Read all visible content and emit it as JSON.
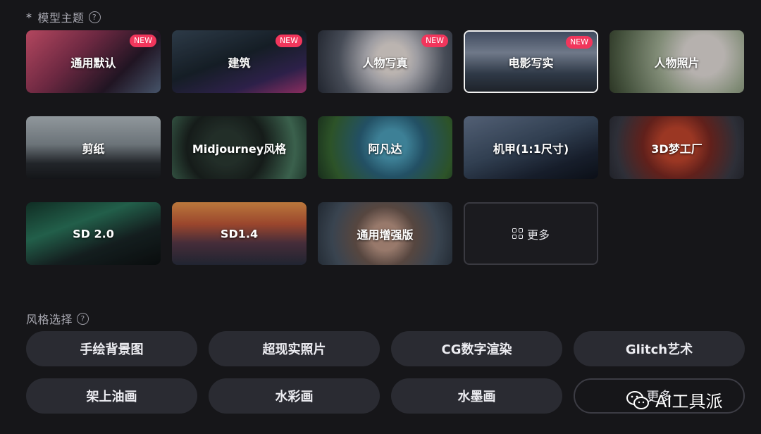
{
  "model_section": {
    "required_mark": "*",
    "title": "模型主题",
    "help_symbol": "?"
  },
  "models": [
    {
      "label": "通用默认",
      "badge": "NEW",
      "selected": false
    },
    {
      "label": "建筑",
      "badge": "NEW",
      "selected": false
    },
    {
      "label": "人物写真",
      "badge": "NEW",
      "selected": false
    },
    {
      "label": "电影写实",
      "badge": "NEW",
      "selected": true
    },
    {
      "label": "人物照片",
      "badge": "",
      "selected": false
    },
    {
      "label": "剪纸",
      "badge": "",
      "selected": false
    },
    {
      "label": "Midjourney风格",
      "badge": "",
      "selected": false
    },
    {
      "label": "阿凡达",
      "badge": "",
      "selected": false
    },
    {
      "label": "机甲(1:1尺寸)",
      "badge": "",
      "selected": false
    },
    {
      "label": "3D梦工厂",
      "badge": "",
      "selected": false
    },
    {
      "label": "SD 2.0",
      "badge": "",
      "selected": false
    },
    {
      "label": "SD1.4",
      "badge": "",
      "selected": false
    },
    {
      "label": "通用增强版",
      "badge": "",
      "selected": false
    }
  ],
  "models_more": {
    "label": "更多",
    "icon": "grid-icon"
  },
  "style_section": {
    "title": "风格选择",
    "help_symbol": "?"
  },
  "styles": [
    {
      "label": "手绘背景图"
    },
    {
      "label": "超现实照片"
    },
    {
      "label": "CG数字渲染"
    },
    {
      "label": "Glitch艺术"
    },
    {
      "label": "架上油画"
    },
    {
      "label": "水彩画"
    },
    {
      "label": "水墨画"
    }
  ],
  "styles_more": {
    "label": "更多"
  },
  "watermark": {
    "text": "AI工具派",
    "icon": "wechat-icon"
  },
  "colors": {
    "background": "#161619",
    "badge": "#f1365c",
    "pill": "#2a2b32",
    "text": "#ededf2"
  }
}
